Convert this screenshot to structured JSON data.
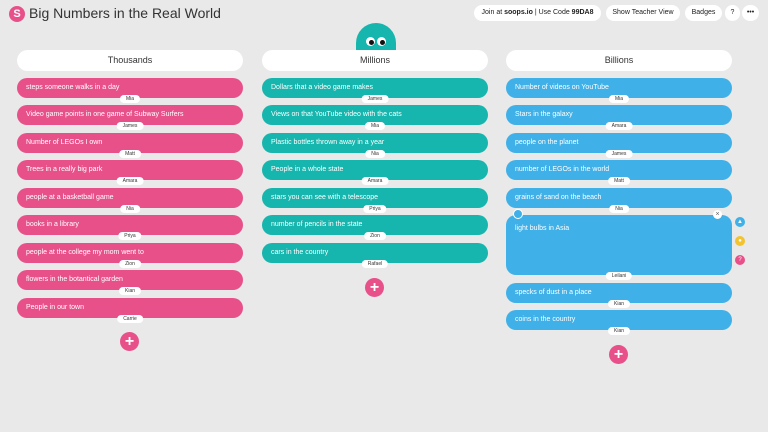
{
  "header": {
    "logo": "S",
    "title": "Big Numbers in the Real World",
    "join_prefix": "Join at ",
    "join_site": "soops.io",
    "join_mid": " | Use Code ",
    "join_code": "99DA8",
    "teacher_view": "Show Teacher View",
    "badges": "Badges",
    "help": "?",
    "more": "•••"
  },
  "columns": [
    {
      "title": "Thousands",
      "cards": [
        {
          "text": "steps someone walks in a day",
          "author": "Mia"
        },
        {
          "text": "Video game points in one game of Subway Surfers",
          "author": "James"
        },
        {
          "text": "Number of LEGOs I own",
          "author": "Matt"
        },
        {
          "text": "Trees in a really big park",
          "author": "Amara"
        },
        {
          "text": "people at a basketball game",
          "author": "Nia"
        },
        {
          "text": "books in a library",
          "author": "Priya"
        },
        {
          "text": "people at the college my mom went to",
          "author": "Zion"
        },
        {
          "text": "flowers in the botantical garden",
          "author": "Kian"
        },
        {
          "text": "People in our town",
          "author": "Carrie"
        }
      ]
    },
    {
      "title": "Millions",
      "cards": [
        {
          "text": "Dollars that a video game makes",
          "author": "James"
        },
        {
          "text": "Views on that YouTube video with the cats",
          "author": "Mia"
        },
        {
          "text": "Plastic bottles thrown away in a year",
          "author": "Nia"
        },
        {
          "text": "People in a whole state",
          "author": "Amara"
        },
        {
          "text": "stars you can see with a telescope",
          "author": "Priya"
        },
        {
          "text": "number of pencils in the state",
          "author": "Zion"
        },
        {
          "text": "cars in the country",
          "author": "Rafael"
        }
      ]
    },
    {
      "title": "Billions",
      "cards": [
        {
          "text": "Number of videos on YouTube",
          "author": "Mia"
        },
        {
          "text": "Stars in the galaxy",
          "author": "Amara"
        },
        {
          "text": "people on the planet",
          "author": "James"
        },
        {
          "text": "number of LEGOs in the world",
          "author": "Matt"
        },
        {
          "text": "grains of sand on the beach",
          "author": "Nia"
        },
        {
          "text": "light bulbs in Asia",
          "author": "Leilani"
        },
        {
          "text": "specks of dust in a place",
          "author": "Kian"
        },
        {
          "text": "coins in the country",
          "author": "Kian"
        }
      ]
    }
  ],
  "add_label": "+",
  "close_label": "×",
  "side_icons": [
    "thumbs-up-icon",
    "idea-icon",
    "question-icon"
  ],
  "colors": {
    "pink": "#e8508a",
    "teal": "#16b5ad",
    "blue": "#3fb0e8"
  }
}
